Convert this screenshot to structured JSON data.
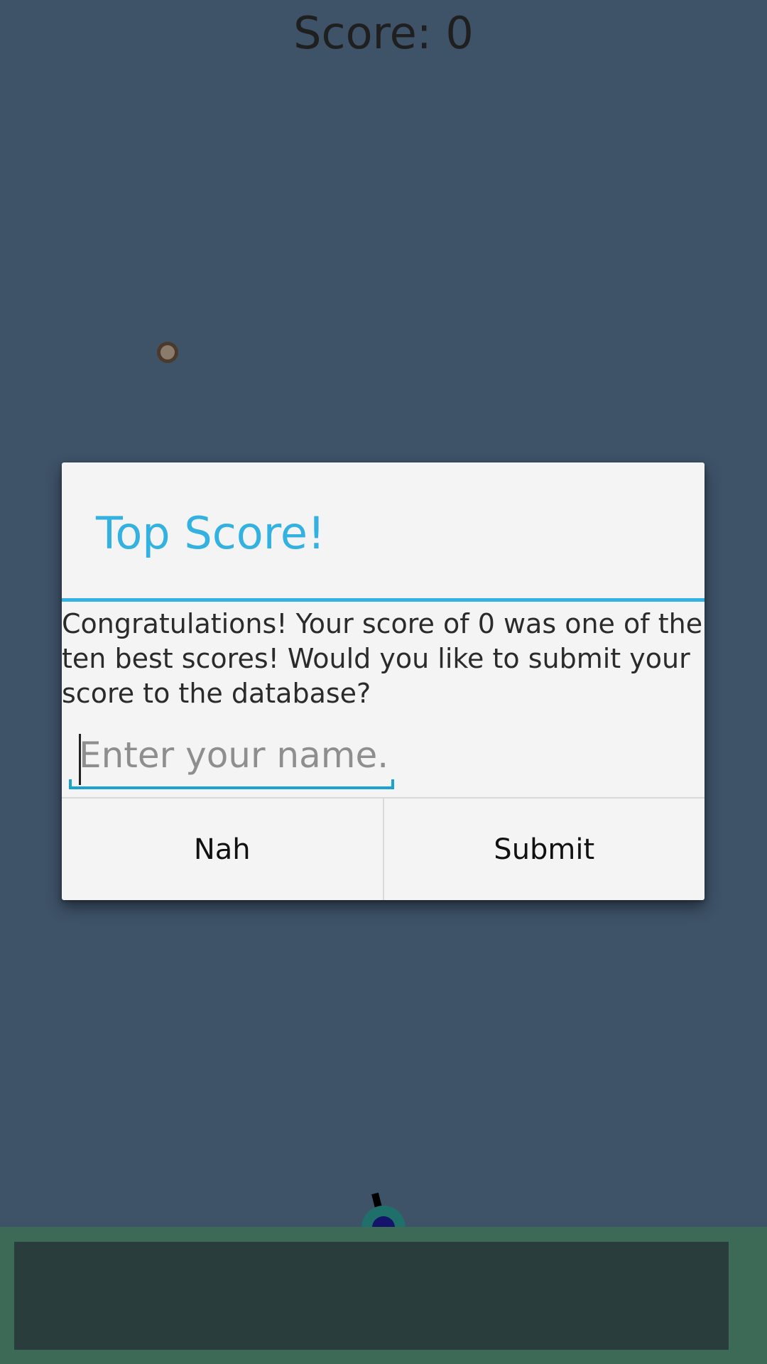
{
  "hud": {
    "score_text": "Score: 0"
  },
  "dialog": {
    "title": "Top Score!",
    "message": "Congratulations! Your score of 0 was one of the ten best scores! Would you like to submit your score to the database?",
    "name_input": {
      "value": "",
      "placeholder": "Enter your name."
    },
    "buttons": {
      "negative": "Nah",
      "positive": "Submit"
    }
  },
  "colors": {
    "background": "#3e5268",
    "accent": "#33b1e0",
    "ground": "#3d6a56",
    "ground_panel": "#2a3d3d",
    "dialog_background": "#f5f4f5"
  },
  "icons": {
    "ball": "ball-icon",
    "cannon": "cannon-icon"
  }
}
